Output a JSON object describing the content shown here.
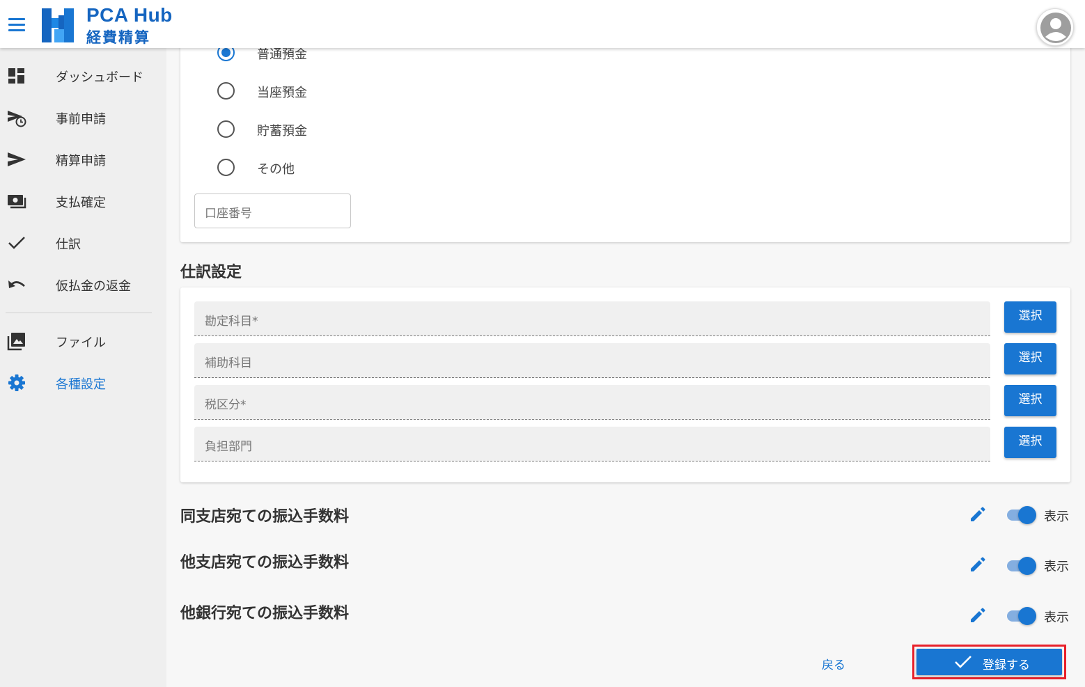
{
  "header": {
    "brand_title": "PCA Hub",
    "brand_subtitle": "経費精算",
    "accent_color": "#1976d2"
  },
  "sidebar": {
    "items": [
      {
        "label": "ダッシュボード",
        "icon": "dashboard-icon"
      },
      {
        "label": "事前申請",
        "icon": "send-clock-icon"
      },
      {
        "label": "精算申請",
        "icon": "send-icon"
      },
      {
        "label": "支払確定",
        "icon": "payment-icon"
      },
      {
        "label": "仕訳",
        "icon": "check-icon"
      },
      {
        "label": "仮払金の返金",
        "icon": "undo-icon"
      },
      {
        "label": "ファイル",
        "icon": "image-icon"
      },
      {
        "label": "各種設定",
        "icon": "gear-icon",
        "active": true
      }
    ]
  },
  "account_type": {
    "options": [
      "普通預金",
      "当座預金",
      "貯蓄預金",
      "その他"
    ],
    "selected": "普通預金"
  },
  "account_number": {
    "placeholder": "口座番号"
  },
  "journal": {
    "title": "仕訳設定",
    "fields": [
      {
        "label": "勘定科目*",
        "button": "選択"
      },
      {
        "label": "補助科目",
        "button": "選択"
      },
      {
        "label": "税区分*",
        "button": "選択"
      },
      {
        "label": "負担部門",
        "button": "選択"
      }
    ]
  },
  "fees": [
    {
      "title": "同支店宛ての振込手数料",
      "toggle_label": "表示",
      "on": true
    },
    {
      "title": "他支店宛ての振込手数料",
      "toggle_label": "表示",
      "on": true
    },
    {
      "title": "他銀行宛ての振込手数料",
      "toggle_label": "表示",
      "on": true
    }
  ],
  "footer": {
    "back_label": "戻る",
    "submit_label": "登録する"
  }
}
